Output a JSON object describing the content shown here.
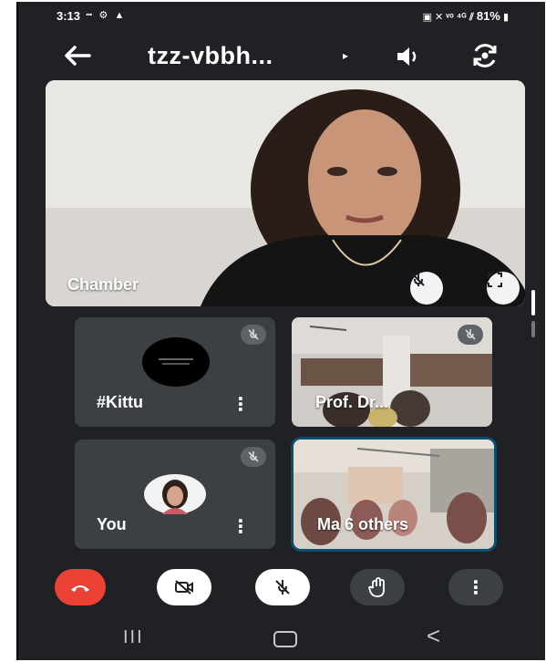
{
  "status_bar": {
    "time": "3:13",
    "left_icons": "ⵈ ⚙ ▲",
    "right_icons": "▣ ✕ ᵛᵒ ⁴ᴳ ⫽",
    "battery": "81%"
  },
  "header": {
    "back_icon": "arrow-left-icon",
    "meeting_code": "tzz-vbbh...",
    "caret": "▸"
  },
  "main_tile": {
    "name": "Chamber"
  },
  "tiles": [
    {
      "name": "#Kittu"
    },
    {
      "name": "Prof. Dr..."
    },
    {
      "name": "You"
    },
    {
      "name": "Ma",
      "others": "6 others"
    }
  ],
  "more_symbol": "⋮",
  "colors": {
    "background": "#202124",
    "tile": "#3c4043",
    "end_call": "#ea4335",
    "active_border": "#0b4f6c"
  },
  "navbar": {
    "recents": "III",
    "back": "<"
  }
}
